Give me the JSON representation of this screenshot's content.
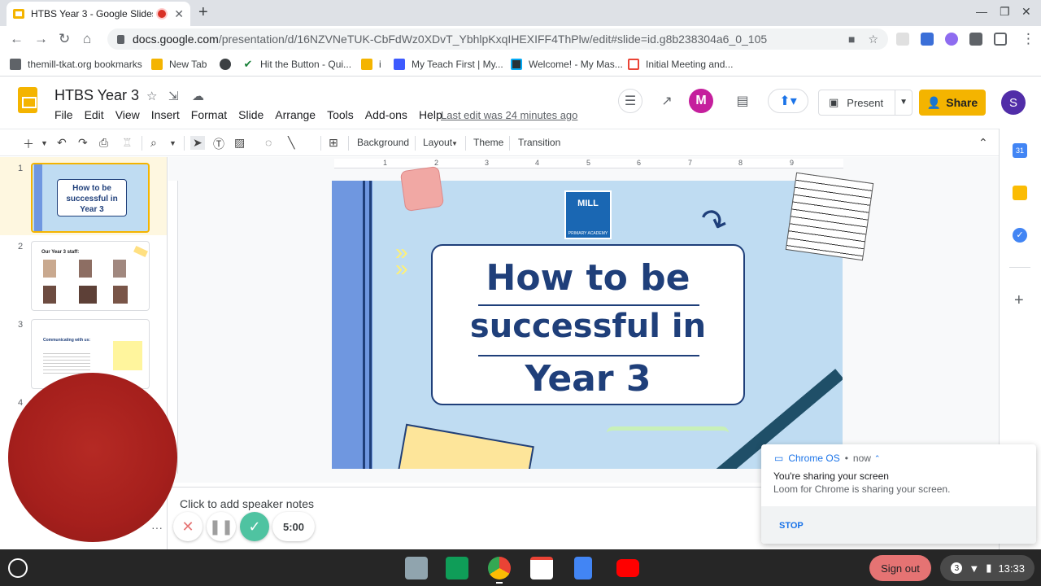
{
  "browser": {
    "tab_title": "HTBS Year 3 - Google Slides",
    "url_host": "docs.google.com",
    "url_path": "/presentation/d/16NZVNeTUK-CbFdWz0XDvT_YbhlpKxqIHEXIFF4ThPlw/edit#slide=id.g8b238304a6_0_105"
  },
  "bookmarks": [
    "themill-tkat.org bookmarks",
    "New Tab",
    "Hit the Button - Qui...",
    "i",
    "My Teach First | My...",
    "Welcome! - My Mas...",
    "Initial Meeting and..."
  ],
  "doc": {
    "title": "HTBS Year 3",
    "menu": [
      "File",
      "Edit",
      "View",
      "Insert",
      "Format",
      "Slide",
      "Arrange",
      "Tools",
      "Add-ons",
      "Help"
    ],
    "last_edit": "Last edit was 24 minutes ago",
    "present_label": "Present",
    "share_label": "Share",
    "avatar_letter": "S"
  },
  "toolbar": {
    "background": "Background",
    "layout": "Layout",
    "theme": "Theme",
    "transition": "Transition"
  },
  "ruler_ticks": [
    "1",
    "2",
    "3",
    "4",
    "5",
    "6",
    "7",
    "8",
    "9"
  ],
  "thumbnails": [
    {
      "num": "1",
      "title": "How to be successful in Year 3"
    },
    {
      "num": "2",
      "title": "Our Year 3 staff:"
    },
    {
      "num": "3",
      "title": "Communicating with us:"
    },
    {
      "num": "4",
      "title": ""
    }
  ],
  "slide": {
    "title_line1": "How to be",
    "title_line2": "successful in",
    "title_line3": "Year 3",
    "logo_text": "MILL",
    "logo_sub": "PRIMARY ACADEMY"
  },
  "speaker_notes_placeholder": "Click to add speaker notes",
  "loom": {
    "timer": "5:00"
  },
  "notification": {
    "source": "Chrome OS",
    "time": "now",
    "title": "You're sharing your screen",
    "message": "Loom for Chrome is sharing your screen.",
    "action": "STOP"
  },
  "shelf": {
    "signout": "Sign out",
    "notif_count": "3",
    "time": "13:33"
  },
  "colors": {
    "slides_yellow": "#f4b400",
    "slide_bg": "#bfdcf2",
    "title_navy": "#1f3f7a",
    "loom_red": "#a8231f"
  }
}
